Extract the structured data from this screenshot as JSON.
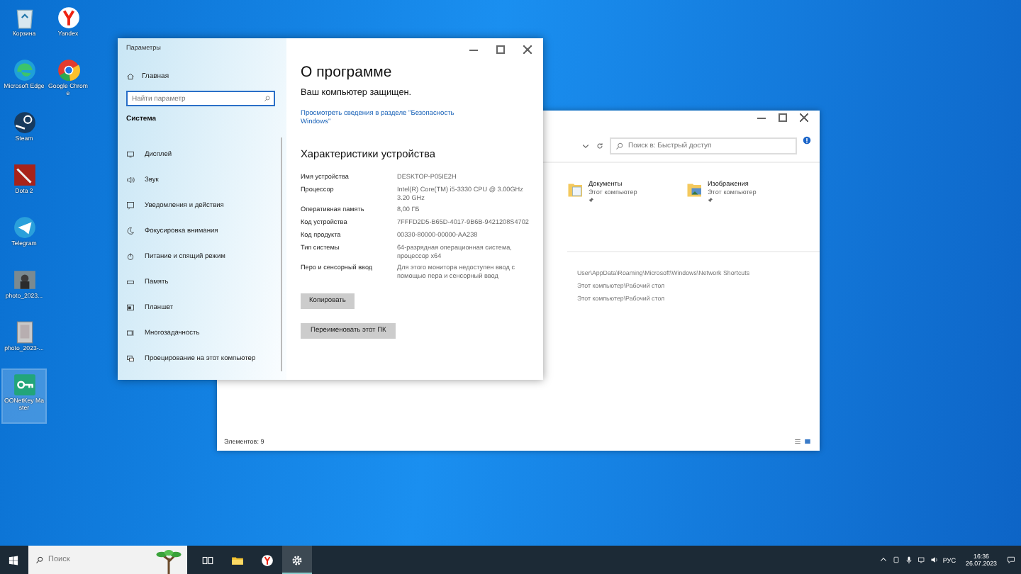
{
  "desktop_icons": [
    {
      "kind": "recycle",
      "label": "Корзина",
      "selected": false
    },
    {
      "kind": "edge",
      "label": "Microsoft Edge",
      "selected": false
    },
    {
      "kind": "steam",
      "label": "Steam",
      "selected": false
    },
    {
      "kind": "dota",
      "label": "Dota 2",
      "selected": false
    },
    {
      "kind": "telegram",
      "label": "Telegram",
      "selected": false
    },
    {
      "kind": "photo",
      "label": "photo_2023...",
      "selected": false
    },
    {
      "kind": "doc",
      "label": "photo_2023-...",
      "selected": false
    },
    {
      "kind": "key",
      "label": "OONetKey Master",
      "selected": true
    },
    {
      "kind": "yandex",
      "label": "Yandex",
      "selected": false
    },
    {
      "kind": "chrome",
      "label": "Google Chrome",
      "selected": false
    }
  ],
  "explorer": {
    "search_placeholder": "Поиск в: Быстрый доступ",
    "items": [
      {
        "kind": "documents",
        "name": "Документы",
        "location": "Этот компьютер"
      },
      {
        "kind": "pictures",
        "name": "Изображения",
        "location": "Этот компьютер"
      }
    ],
    "recent_paths": [
      "User\\AppData\\Roaming\\Microsoft\\Windows\\Network Shortcuts",
      "Этот компьютер\\Рабочий стол",
      "Этот компьютер\\Рабочий стол"
    ],
    "status": "Элементов: 9"
  },
  "settings": {
    "title": "Параметры",
    "home": "Главная",
    "search_placeholder": "Найти параметр",
    "section": "Система",
    "nav_items": [
      {
        "kind": "display",
        "label": "Дисплей"
      },
      {
        "kind": "sound",
        "label": "Звук"
      },
      {
        "kind": "notifications",
        "label": "Уведомления и действия"
      },
      {
        "kind": "focus",
        "label": "Фокусировка внимания"
      },
      {
        "kind": "power",
        "label": "Питание и спящий режим"
      },
      {
        "kind": "storage",
        "label": "Память"
      },
      {
        "kind": "tablet",
        "label": "Планшет"
      },
      {
        "kind": "multitask",
        "label": "Многозадачность"
      },
      {
        "kind": "project",
        "label": "Проецирование на этот компьютер"
      }
    ],
    "page_title": "О программе",
    "protected": "Ваш компьютер защищен.",
    "security_link": "Просмотреть сведения в разделе \"Безопасность Windows\"",
    "specs_heading": "Характеристики устройства",
    "specs": [
      {
        "label": "Имя устройства",
        "value": "DESKTOP-P05IE2H"
      },
      {
        "label": "Процессор",
        "value": "Intel(R) Core(TM) i5-3330 CPU @ 3.00GHz   3.20 GHz"
      },
      {
        "label": "Оперативная память",
        "value": "8,00 ГБ"
      },
      {
        "label": "Код устройства",
        "value": "7FFFD2D5-B65D-4017-9B6B-9421208S4702"
      },
      {
        "label": "Код продукта",
        "value": "00330-80000-00000-AA238"
      },
      {
        "label": "Тип системы",
        "value": "64-разрядная операционная система, процессор x64"
      },
      {
        "label": "Перо и сенсорный ввод",
        "value": "Для этого монитора недоступен ввод с помощью пера и сенсорный ввод"
      }
    ],
    "buttons": [
      "Копировать",
      "Переименовать этот ПК"
    ]
  },
  "taskbar": {
    "search_placeholder": "Поиск",
    "apps": [
      {
        "kind": "taskview",
        "active": false
      },
      {
        "kind": "explorer",
        "active": false
      },
      {
        "kind": "yandex",
        "active": false
      },
      {
        "kind": "settings",
        "active": true
      }
    ],
    "language": "РУС",
    "time": "16:36",
    "date": "26.07.2023"
  }
}
